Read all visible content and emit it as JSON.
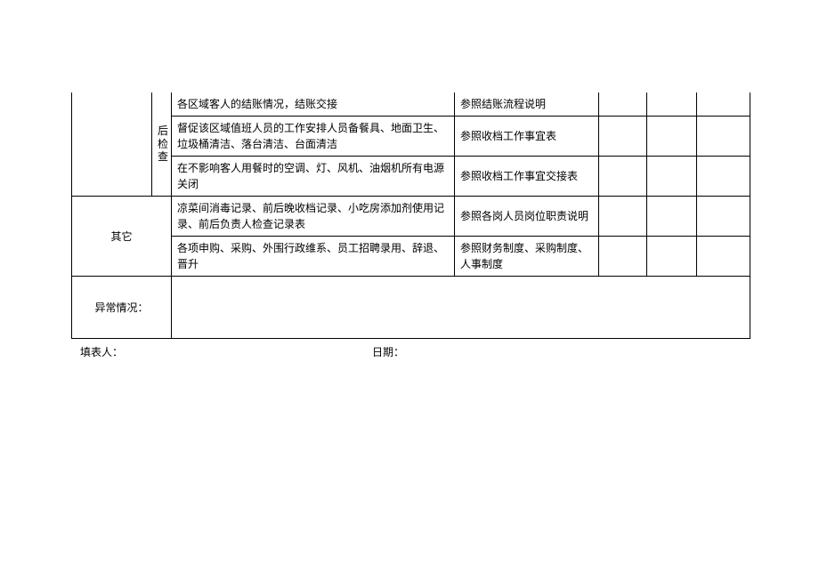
{
  "rows": [
    {
      "stage": "后",
      "task": "各区域客人的结账情况，结账交接",
      "ref": "参照结账流程说明"
    },
    {
      "stage": "检",
      "task": "督促该区域值班人员的工作安排人员备餐具、地面卫生、垃圾桶清洁、落台清洁、台面清洁",
      "ref": "参照收档工作事宜表"
    },
    {
      "stage": "查",
      "task": "在不影响客人用餐时的空调、灯、风机、油烟机所有电源关闭",
      "ref": "参照收档工作事宜交接表"
    }
  ],
  "other": {
    "label": "其它",
    "items": [
      {
        "task": "凉菜间消毒记录、前后晚收档记录、小吃房添加剂使用记录、前后负责人检查记录表",
        "ref": "参照各岗人员岗位职责说明"
      },
      {
        "task": "各项申购、采购、外围行政维系、员工招聘录用、辞退、晋升",
        "ref": "参照财务制度、采购制度、人事制度"
      }
    ]
  },
  "exception": {
    "label": "异常情况：",
    "value": ""
  },
  "footer": {
    "filler_label": "填表人：",
    "date_label": "日期："
  }
}
